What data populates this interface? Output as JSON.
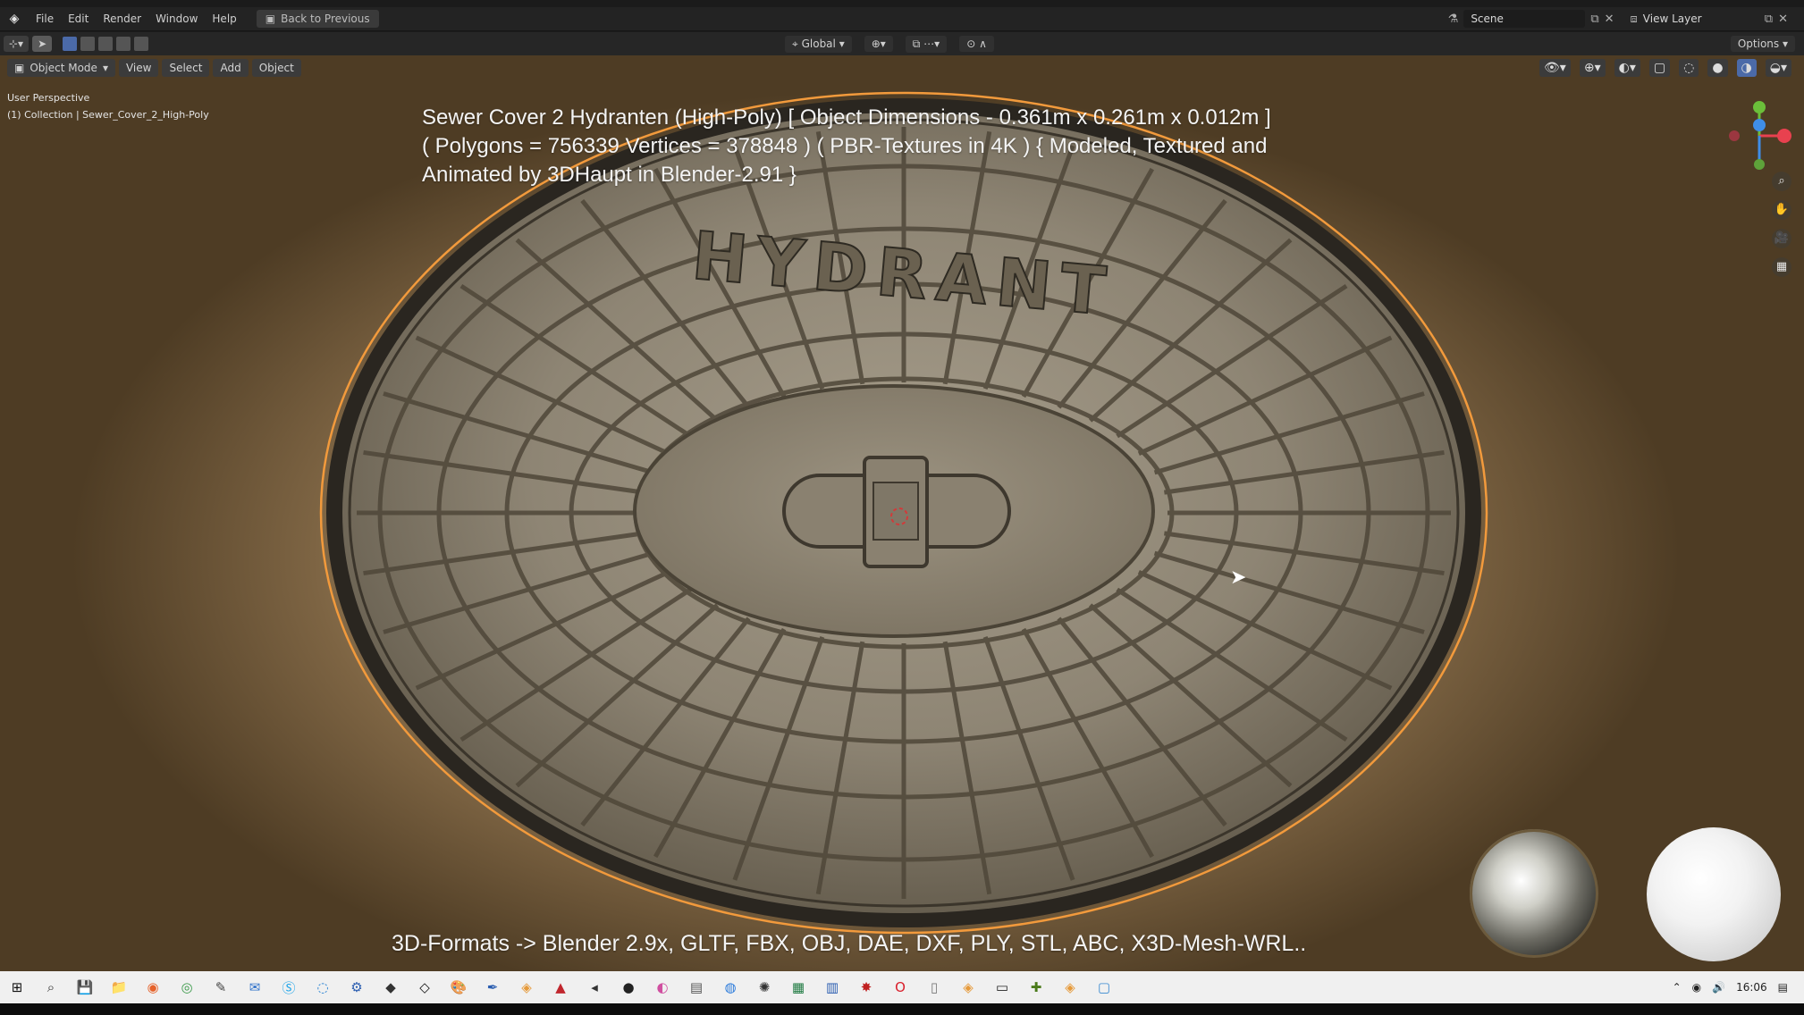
{
  "topbar": {
    "menus": [
      "File",
      "Edit",
      "Render",
      "Window",
      "Help"
    ],
    "back_label": "Back to Previous",
    "scene_label": "Scene",
    "view_layer_label": "View Layer"
  },
  "toolbar": {
    "transform_orientation": "Global",
    "options_label": "Options"
  },
  "viewport": {
    "mode_label": "Object Mode",
    "menus": [
      "View",
      "Select",
      "Add",
      "Object"
    ],
    "perspective_label": "User Perspective",
    "collection_label": "(1) Collection | Sewer_Cover_2_High-Poly",
    "overlay_lines": [
      "Sewer Cover 2 Hydranten (High-Poly) [ Object Dimensions -  0.361m x 0.261m x 0.012m ]",
      "( Polygons = 756339 Vertices = 378848 ) ( PBR-Textures in 4K ) { Modeled, Textured and",
      "Animated by 3DHaupt in Blender-2.91 }"
    ],
    "cover_text": "HYDRANT",
    "formats_text": "3D-Formats -> Blender 2.9x, GLTF, FBX, OBJ, DAE, DXF, PLY, STL, ABC, X3D-Mesh-WRL.."
  },
  "taskbar": {
    "clock": "16:06",
    "icons": [
      "start-icon",
      "search-icon",
      "save-icon",
      "folder-icon",
      "firefox-icon",
      "chrome-icon",
      "notepad-icon",
      "outlook-icon",
      "skype-icon",
      "edge-icon",
      "settings-icon",
      "app-icon",
      "unity-icon",
      "paint-icon",
      "vector-icon",
      "blender-icon",
      "acrobat-icon",
      "app2-icon",
      "obs-icon",
      "photo-icon",
      "calc-icon",
      "maps-icon",
      "app3-icon",
      "excel-icon",
      "word-icon",
      "star-icon",
      "opera-icon",
      "file-icon",
      "blender2-icon",
      "terminal-icon",
      "app4-icon",
      "blender3-icon",
      "window-icon"
    ]
  },
  "colors": {
    "accent_blue": "#4b6aa8",
    "selection_orange": "#f29a3c",
    "gizmo_x": "#e8414f",
    "gizmo_y": "#6bbf3a",
    "gizmo_z": "#3f8ee8"
  }
}
